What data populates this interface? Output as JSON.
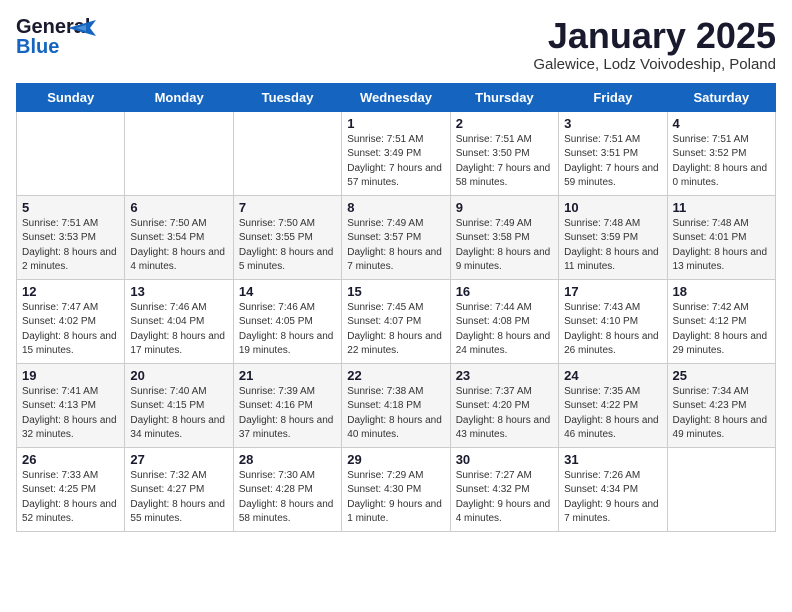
{
  "header": {
    "logo_general": "General",
    "logo_blue": "Blue",
    "month_title": "January 2025",
    "location": "Galewice, Lodz Voivodeship, Poland"
  },
  "weekdays": [
    "Sunday",
    "Monday",
    "Tuesday",
    "Wednesday",
    "Thursday",
    "Friday",
    "Saturday"
  ],
  "weeks": [
    [
      {
        "day": "",
        "info": ""
      },
      {
        "day": "",
        "info": ""
      },
      {
        "day": "",
        "info": ""
      },
      {
        "day": "1",
        "info": "Sunrise: 7:51 AM\nSunset: 3:49 PM\nDaylight: 7 hours and 57 minutes."
      },
      {
        "day": "2",
        "info": "Sunrise: 7:51 AM\nSunset: 3:50 PM\nDaylight: 7 hours and 58 minutes."
      },
      {
        "day": "3",
        "info": "Sunrise: 7:51 AM\nSunset: 3:51 PM\nDaylight: 7 hours and 59 minutes."
      },
      {
        "day": "4",
        "info": "Sunrise: 7:51 AM\nSunset: 3:52 PM\nDaylight: 8 hours and 0 minutes."
      }
    ],
    [
      {
        "day": "5",
        "info": "Sunrise: 7:51 AM\nSunset: 3:53 PM\nDaylight: 8 hours and 2 minutes."
      },
      {
        "day": "6",
        "info": "Sunrise: 7:50 AM\nSunset: 3:54 PM\nDaylight: 8 hours and 4 minutes."
      },
      {
        "day": "7",
        "info": "Sunrise: 7:50 AM\nSunset: 3:55 PM\nDaylight: 8 hours and 5 minutes."
      },
      {
        "day": "8",
        "info": "Sunrise: 7:49 AM\nSunset: 3:57 PM\nDaylight: 8 hours and 7 minutes."
      },
      {
        "day": "9",
        "info": "Sunrise: 7:49 AM\nSunset: 3:58 PM\nDaylight: 8 hours and 9 minutes."
      },
      {
        "day": "10",
        "info": "Sunrise: 7:48 AM\nSunset: 3:59 PM\nDaylight: 8 hours and 11 minutes."
      },
      {
        "day": "11",
        "info": "Sunrise: 7:48 AM\nSunset: 4:01 PM\nDaylight: 8 hours and 13 minutes."
      }
    ],
    [
      {
        "day": "12",
        "info": "Sunrise: 7:47 AM\nSunset: 4:02 PM\nDaylight: 8 hours and 15 minutes."
      },
      {
        "day": "13",
        "info": "Sunrise: 7:46 AM\nSunset: 4:04 PM\nDaylight: 8 hours and 17 minutes."
      },
      {
        "day": "14",
        "info": "Sunrise: 7:46 AM\nSunset: 4:05 PM\nDaylight: 8 hours and 19 minutes."
      },
      {
        "day": "15",
        "info": "Sunrise: 7:45 AM\nSunset: 4:07 PM\nDaylight: 8 hours and 22 minutes."
      },
      {
        "day": "16",
        "info": "Sunrise: 7:44 AM\nSunset: 4:08 PM\nDaylight: 8 hours and 24 minutes."
      },
      {
        "day": "17",
        "info": "Sunrise: 7:43 AM\nSunset: 4:10 PM\nDaylight: 8 hours and 26 minutes."
      },
      {
        "day": "18",
        "info": "Sunrise: 7:42 AM\nSunset: 4:12 PM\nDaylight: 8 hours and 29 minutes."
      }
    ],
    [
      {
        "day": "19",
        "info": "Sunrise: 7:41 AM\nSunset: 4:13 PM\nDaylight: 8 hours and 32 minutes."
      },
      {
        "day": "20",
        "info": "Sunrise: 7:40 AM\nSunset: 4:15 PM\nDaylight: 8 hours and 34 minutes."
      },
      {
        "day": "21",
        "info": "Sunrise: 7:39 AM\nSunset: 4:16 PM\nDaylight: 8 hours and 37 minutes."
      },
      {
        "day": "22",
        "info": "Sunrise: 7:38 AM\nSunset: 4:18 PM\nDaylight: 8 hours and 40 minutes."
      },
      {
        "day": "23",
        "info": "Sunrise: 7:37 AM\nSunset: 4:20 PM\nDaylight: 8 hours and 43 minutes."
      },
      {
        "day": "24",
        "info": "Sunrise: 7:35 AM\nSunset: 4:22 PM\nDaylight: 8 hours and 46 minutes."
      },
      {
        "day": "25",
        "info": "Sunrise: 7:34 AM\nSunset: 4:23 PM\nDaylight: 8 hours and 49 minutes."
      }
    ],
    [
      {
        "day": "26",
        "info": "Sunrise: 7:33 AM\nSunset: 4:25 PM\nDaylight: 8 hours and 52 minutes."
      },
      {
        "day": "27",
        "info": "Sunrise: 7:32 AM\nSunset: 4:27 PM\nDaylight: 8 hours and 55 minutes."
      },
      {
        "day": "28",
        "info": "Sunrise: 7:30 AM\nSunset: 4:28 PM\nDaylight: 8 hours and 58 minutes."
      },
      {
        "day": "29",
        "info": "Sunrise: 7:29 AM\nSunset: 4:30 PM\nDaylight: 9 hours and 1 minute."
      },
      {
        "day": "30",
        "info": "Sunrise: 7:27 AM\nSunset: 4:32 PM\nDaylight: 9 hours and 4 minutes."
      },
      {
        "day": "31",
        "info": "Sunrise: 7:26 AM\nSunset: 4:34 PM\nDaylight: 9 hours and 7 minutes."
      },
      {
        "day": "",
        "info": ""
      }
    ]
  ]
}
